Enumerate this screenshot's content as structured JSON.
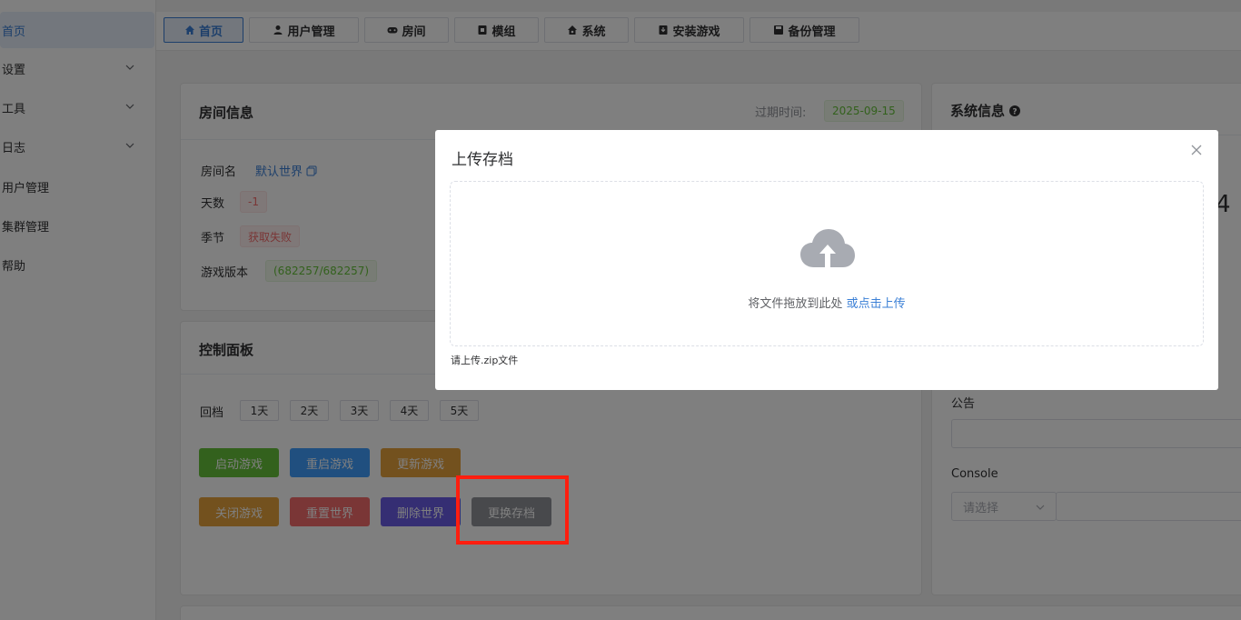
{
  "sidebar": {
    "items": [
      {
        "label": "首页",
        "active": true
      },
      {
        "label": "设置",
        "expandable": true
      },
      {
        "label": "工具",
        "expandable": true
      },
      {
        "label": "日志",
        "expandable": true
      },
      {
        "label": "用户管理"
      },
      {
        "label": "集群管理"
      },
      {
        "label": "帮助"
      }
    ]
  },
  "tabs": [
    {
      "label": "首页",
      "icon": "home-icon",
      "active": true
    },
    {
      "label": "用户管理",
      "icon": "user-icon"
    },
    {
      "label": "房间",
      "icon": "gamepad-icon"
    },
    {
      "label": "模组",
      "icon": "module-icon"
    },
    {
      "label": "系统",
      "icon": "system-icon"
    },
    {
      "label": "安装游戏",
      "icon": "install-icon"
    },
    {
      "label": "备份管理",
      "icon": "save-icon"
    }
  ],
  "room_info": {
    "title": "房间信息",
    "expire_label": "过期时间:",
    "expire_value": "2025-09-15",
    "room_name_label": "房间名",
    "room_name_value": "默认世界",
    "days_label": "天数",
    "days_value": "-1",
    "season_label": "季节",
    "season_value": "获取失败",
    "version_label": "游戏版本",
    "version_value": "(682257/682257)"
  },
  "control_panel": {
    "title": "控制面板",
    "rollback_label": "回档",
    "rollback_days": [
      "1天",
      "2天",
      "3天",
      "4天",
      "5天"
    ],
    "buttons_row1": [
      "启动游戏",
      "重启游戏",
      "更新游戏"
    ],
    "buttons_row2": [
      "关闭游戏",
      "重置世界",
      "删除世界",
      "更换存档"
    ]
  },
  "system_info": {
    "title": "系统信息",
    "partial_number": "4",
    "announcement_label": "公告",
    "console_label": "Console",
    "console_select_placeholder": "请选择"
  },
  "upload_dialog": {
    "title": "上传存档",
    "drop_text": "将文件拖放到此处",
    "click_text": "或点击上传",
    "tip": "请上传.zip文件"
  },
  "colors": {
    "accent": "#3a7fd6",
    "green": "#67c23a",
    "blue_btn": "#409eff",
    "orange_btn": "#e6a23c",
    "red_btn": "#f56c6c",
    "purple_btn": "#6b5ce7",
    "gray_btn": "#909399",
    "highlight": "#ff1e0f"
  }
}
